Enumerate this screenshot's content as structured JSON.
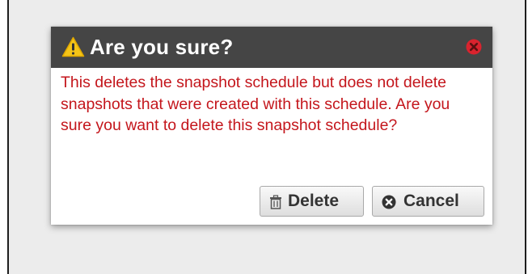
{
  "dialog": {
    "title": "Are you sure?",
    "title_icon": "warning-triangle-icon",
    "close_icon": "close-circle-icon",
    "message": "This deletes the snapshot schedule but does not delete snapshots that were created with this schedule. Are you sure you want to delete this snapshot schedule?",
    "buttons": {
      "delete_label": "Delete",
      "delete_icon": "trash-icon",
      "cancel_label": "Cancel",
      "cancel_icon": "cancel-circle-icon"
    }
  },
  "colors": {
    "title_bar": "#454545",
    "message_text": "#c4161c",
    "warning": "#f5c518",
    "close": "#d9232e",
    "backdrop": "#ececec"
  }
}
